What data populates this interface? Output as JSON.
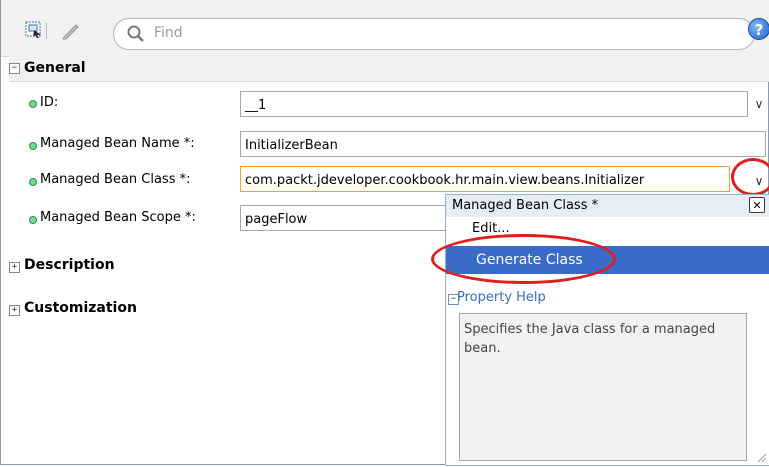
{
  "toolbar": {
    "find_placeholder": "Find",
    "help_glyph": "?"
  },
  "sections": {
    "general": "General",
    "description": "Description",
    "customization": "Customization"
  },
  "fields": [
    {
      "label": "ID:",
      "value": "__1"
    },
    {
      "label": "Managed Bean Name *:",
      "value": "InitializerBean"
    },
    {
      "label": "Managed Bean Class *:",
      "value": "com.packt.jdeveloper.cookbook.hr.main.view.beans.Initializer"
    },
    {
      "label": "Managed Bean Scope *:",
      "value": "pageFlow"
    }
  ],
  "popup": {
    "title": "Managed Bean Class *",
    "close_glyph": "✕",
    "edit_label": "Edit...",
    "generate_label": "Generate Class",
    "property_help_label": "Property Help",
    "help_text": "Specifies the Java class for a managed bean."
  },
  "colors": {
    "highlight": "#3b6bc9",
    "annotation_red": "#e21d1d",
    "required_dot": "#1a9d4b",
    "focus_border": "#f3a232"
  },
  "icons": [
    "component-select-icon",
    "pencil-icon",
    "search-icon",
    "help-icon",
    "expand-icon",
    "collapse-icon",
    "dropdown-chevron-icon",
    "close-icon"
  ]
}
